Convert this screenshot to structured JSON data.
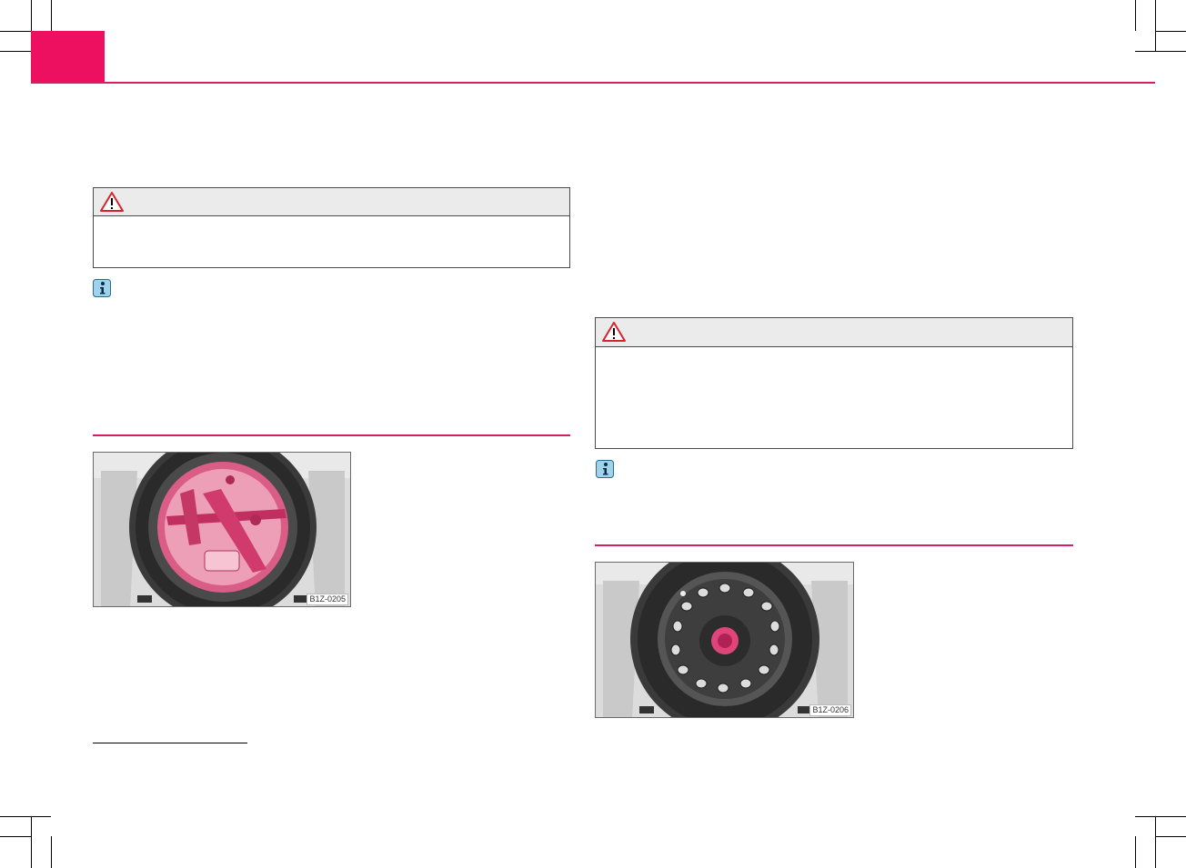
{
  "brand": {
    "accent": "#e5105a",
    "rule": "#d81e62"
  },
  "header": {
    "tab_color": "#ee1060"
  },
  "left_column": {
    "warning_icon": "warning-triangle-icon",
    "info_icon": "info-icon",
    "figure": {
      "code": "B1Z-0205",
      "subject": "spare wheel well with red tool kit insert"
    }
  },
  "right_column": {
    "warning_icon": "warning-triangle-icon",
    "info_icon": "info-icon",
    "figure": {
      "code": "B1Z-0206",
      "subject": "spare wheel with red central bolt"
    }
  }
}
